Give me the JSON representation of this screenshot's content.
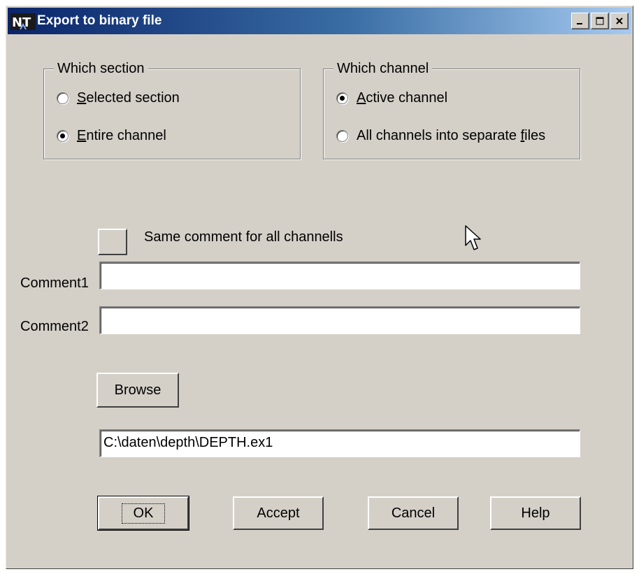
{
  "window": {
    "title": "Export to binary file",
    "app_icon": "app-logo-icon",
    "controls": [
      "minimize-icon",
      "maximize-icon",
      "close-icon"
    ]
  },
  "section_group": {
    "label": "Which section",
    "options": [
      {
        "label": "Selected section",
        "accel": "S",
        "rest": "elected section",
        "checked": false
      },
      {
        "label": "Entire channel",
        "accel": "E",
        "rest": "ntire channel",
        "checked": true
      }
    ]
  },
  "channel_group": {
    "label": "Which channel",
    "options": [
      {
        "label": "Active channel",
        "accel": "A",
        "rest": "ctive channel",
        "checked": true
      },
      {
        "label": "All channels into separate files",
        "pre": "All channels into separate ",
        "accel": "f",
        "rest": "iles",
        "checked": false
      }
    ]
  },
  "same_comment": {
    "label": "Same comment for all channells"
  },
  "comments": {
    "comment1_label": "Comment1",
    "comment1_value": "",
    "comment2_label": "Comment2",
    "comment2_value": ""
  },
  "file": {
    "browse_label": "Browse",
    "path": "C:\\daten\\depth\\DEPTH.ex1"
  },
  "actions": {
    "ok": "OK",
    "accept": "Accept",
    "cancel": "Cancel",
    "help": "Help"
  },
  "colors": {
    "face": "#d4d0c8",
    "title_start": "#0a246a",
    "title_end": "#a6caf0"
  }
}
